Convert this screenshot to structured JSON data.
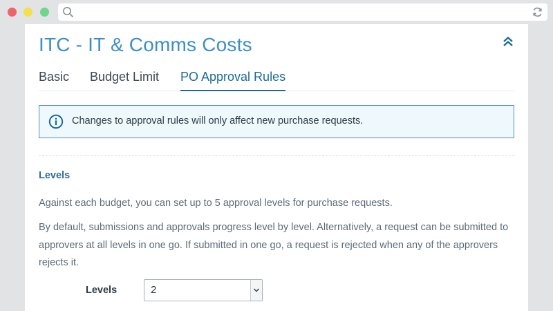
{
  "window": {
    "controls": [
      "close",
      "minimize",
      "maximize"
    ]
  },
  "browser": {
    "url": ""
  },
  "page": {
    "title": "ITC - IT & Comms Costs",
    "tabs": [
      {
        "label": "Basic",
        "active": false
      },
      {
        "label": "Budget Limit",
        "active": false
      },
      {
        "label": "PO Approval Rules",
        "active": true
      }
    ],
    "notice": "Changes to approval rules will only affect new purchase requests.",
    "levels_section": {
      "heading": "Levels",
      "paragraph1": "Against each budget, you can set up to 5 approval levels for purchase requests.",
      "paragraph2": "By default, submissions and approvals progress level by level. Alternatively, a request can be submitted to approvers at all levels in one go. If submitted in one go, a request is rejected when any of the approvers rejects it.",
      "levels_label": "Levels",
      "levels_value": "2"
    }
  },
  "colors": {
    "accent": "#3b8fc9",
    "active_tab": "#1d6a9a",
    "notice_bg": "#eef8fd",
    "notice_border": "#4f8fae"
  },
  "icons": [
    "search-icon",
    "reload-icon",
    "collapse-chevrons-icon",
    "info-icon",
    "chevron-down-icon"
  ]
}
